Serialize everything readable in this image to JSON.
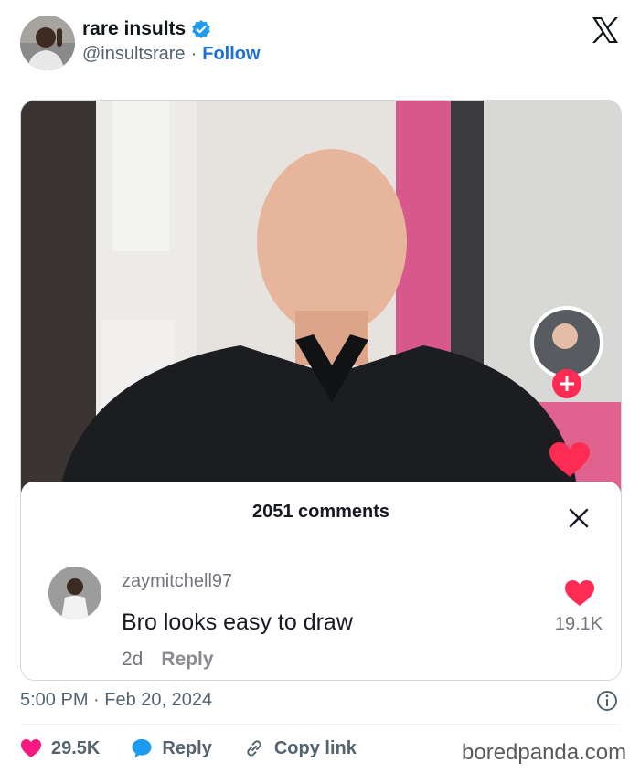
{
  "author": {
    "display_name": "rare insults",
    "handle": "@insultsrare",
    "separator": "·",
    "follow_label": "Follow"
  },
  "embedded": {
    "comments_header": "2051 comments",
    "comment": {
      "username": "zaymitchell97",
      "text": "Bro looks easy to draw",
      "age": "2d",
      "reply_label": "Reply",
      "likes": "19.1K"
    }
  },
  "tweet_meta": {
    "timestamp": "5:00 PM · Feb 20, 2024"
  },
  "actions": {
    "like_count": "29.5K",
    "reply_label": "Reply",
    "copy_label": "Copy link"
  },
  "watermark": "boredpanda.com",
  "colors": {
    "accent_blue": "#1d72d1",
    "like_red": "#f91880",
    "tiktok_red": "#fe2c55",
    "reply_blue": "#1d9bf0"
  },
  "icons": [
    "verified-badge-icon",
    "x-logo-icon",
    "close-icon",
    "heart-icon",
    "info-icon",
    "speech-bubble-icon",
    "link-icon"
  ]
}
